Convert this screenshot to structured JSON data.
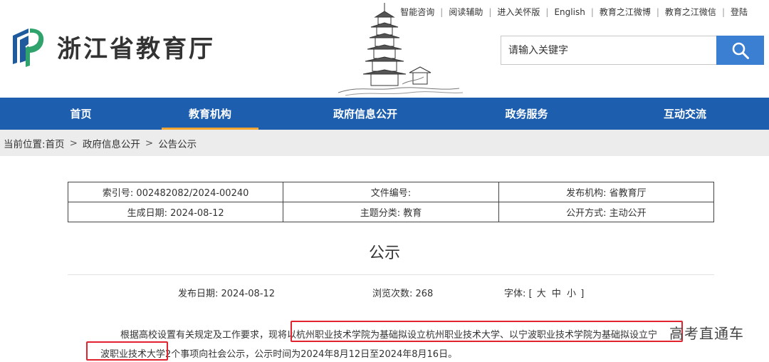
{
  "site": {
    "name": "浙江省教育厅"
  },
  "toplinks": [
    "智能咨询",
    "阅读辅助",
    "进入关怀版",
    "English",
    "教育之江微博",
    "教育之江微信",
    "登陆"
  ],
  "search": {
    "placeholder": "请输入关键字",
    "icon": "search-icon"
  },
  "nav": [
    {
      "label": "首页",
      "active": false
    },
    {
      "label": "教育机构",
      "active": true
    },
    {
      "label": "政府信息公开",
      "active": false
    },
    {
      "label": "政务服务",
      "active": false
    },
    {
      "label": "互动交流",
      "active": false
    }
  ],
  "breadcrumb": {
    "prefix": "当前位置:",
    "items": [
      "首页",
      "政府信息公开",
      "公告公示"
    ],
    "separator": ">"
  },
  "info": {
    "rows": [
      [
        "索引号: 002482082/2024-00240",
        "文件编号:",
        "发布机构: 省教育厅"
      ],
      [
        "生成日期: 2024-08-12",
        "主题分类: 教育",
        "公开方式: 主动公开"
      ]
    ]
  },
  "doc": {
    "title": "公示",
    "publish_date": "发布日期: 2024-08-12",
    "views": "浏览次数: 268",
    "font_label": "字体: [",
    "font_large": "大",
    "font_medium": "中",
    "font_small": "小",
    "font_close": "]",
    "para1_lead": "根据高校设置有关规定及工作要求，现将",
    "para1_highlight": "以杭州职业技术学院为基础拟设立杭州职业技术大学、以宁波职业技术学院为基础拟设立宁",
    "para2_highlight": "波职业技术大学",
    "para2_tail": "2个事项向社会公示，公示时间为2024年8月12日至2024年8月16日。"
  },
  "watermark": {
    "text": "高考直通车"
  },
  "colors": {
    "nav_bg": "#1d5eae",
    "nav_active_underline": "#f3a531",
    "search_button": "#3b7fd3",
    "highlight_box": "#e0232e",
    "breadcrumb_bg": "#ececec"
  }
}
